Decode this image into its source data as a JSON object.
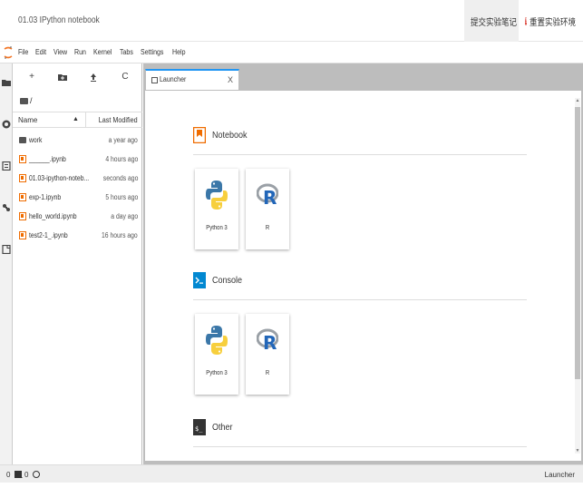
{
  "window": {
    "title": "01.03 IPython notebook"
  },
  "actions": {
    "submit_label": "提交实验笔记",
    "reset_label": "重置实验环境",
    "reset_badge": "!"
  },
  "menu": [
    "File",
    "Edit",
    "View",
    "Run",
    "Kernel",
    "Tabs",
    "Settings",
    "Help"
  ],
  "filebrowser": {
    "tools": {
      "new": "+",
      "refresh": "C"
    },
    "breadcrumb": "/",
    "columns": {
      "name": "Name",
      "modified": "Last Modified",
      "sort_indicator": "▲"
    },
    "files": [
      {
        "name": "work",
        "modified": "a year ago",
        "type": "folder"
      },
      {
        "name": "______.ipynb",
        "modified": "4 hours ago",
        "type": "notebook"
      },
      {
        "name": "01.03-ipython-noteb...",
        "modified": "seconds ago",
        "type": "notebook"
      },
      {
        "name": "exp-1.ipynb",
        "modified": "5 hours ago",
        "type": "notebook"
      },
      {
        "name": "hello_world.ipynb",
        "modified": "a day ago",
        "type": "notebook"
      },
      {
        "name": "test2-1_.ipynb",
        "modified": "16 hours ago",
        "type": "notebook"
      }
    ]
  },
  "tab": {
    "label": "Launcher",
    "close": "X"
  },
  "launcher": {
    "notebook": {
      "title": "Notebook",
      "cards": [
        "Python 3",
        "R"
      ]
    },
    "console": {
      "title": "Console",
      "cards": [
        "Python 3",
        "R"
      ]
    },
    "other": {
      "title": "Other"
    }
  },
  "status": {
    "terminals": "0",
    "kernels": "0",
    "right": "Launcher",
    "term_glyph": "$_"
  },
  "colors": {
    "accent": "#2196f3",
    "notebook_orange": "#ef6c00",
    "console_blue": "#0288d1",
    "danger": "#d9352b"
  }
}
